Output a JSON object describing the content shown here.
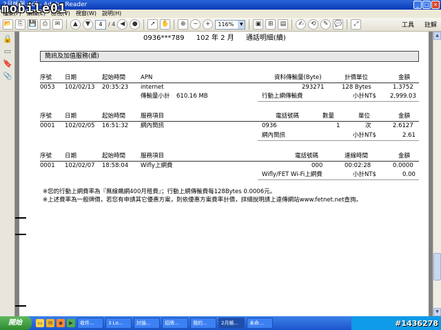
{
  "window": {
    "title": "2月帳單.pdf - Adobe Reader"
  },
  "logo": {
    "text": "mobile01"
  },
  "menu": [
    "檔案(F)",
    "編輯(E)",
    "檢視(V)",
    "視窗(W)",
    "說明(H)"
  ],
  "toolbar": {
    "page_current": "4",
    "page_total": "/ 4",
    "zoom": "116%",
    "tools_label": "工具",
    "comment_label": "註解"
  },
  "doc": {
    "phone": "0936***789",
    "year": "102 年 2 月",
    "title": "通話明細(續)",
    "section_title": "簡訊及加值服務(續)",
    "t1": {
      "headers": [
        "序號",
        "日期",
        "起始時間",
        "APN",
        "資料傳輸量(Byte)",
        "計價單位",
        "金額"
      ],
      "row": [
        "0053",
        "102/02/13",
        "20:35:23",
        "internet",
        "293271",
        "128 Bytes",
        "1.3752"
      ],
      "subtotal_label": "傳輸量小計",
      "subtotal_value": "610.16 MB",
      "fee_label": "行動上網傳輸費",
      "fee_subtotal_label": "小計NT$",
      "fee_value": "2,999.03"
    },
    "t2": {
      "headers": [
        "序號",
        "日期",
        "起始時間",
        "服務項目",
        "電話號碼",
        "數量",
        "單位",
        "金額"
      ],
      "row": [
        "0001",
        "102/02/05",
        "16:51:32",
        "網內簡訊",
        "0936",
        "1",
        "次",
        "2.6127"
      ],
      "subtotal_service": "網內簡訊",
      "subtotal_label": "小計NT$",
      "subtotal_value": "2.61"
    },
    "t3": {
      "headers": [
        "序號",
        "日期",
        "起始時間",
        "服務項目",
        "電話號碼",
        "連線時間",
        "金額"
      ],
      "row": [
        "0001",
        "102/02/07",
        "18:58:04",
        "Wifly上網費",
        "000",
        "00:02:28",
        "0.0000"
      ],
      "subtotal_service": "Wifly/FET Wi-Fi上網費",
      "subtotal_label": "小計NT$",
      "subtotal_value": "0.00"
    },
    "notes": [
      "※您的行動上網費率為『無線飆網400月租費』；行動上網傳輸費每128Bytes 0.0006元。",
      "※上述費率為一般牌價，若您有申請其它優惠方案，則依優惠方案費率計價，詳細說明請上遠傳網站www.fetnet.net查詢。"
    ]
  },
  "taskbar": {
    "start": "開始",
    "tasks": [
      "收件...",
      "3 Lo...",
      "討論...",
      "招牌...",
      "我的...",
      "2月帳...",
      "未命..."
    ],
    "watermark": "#1436278"
  }
}
